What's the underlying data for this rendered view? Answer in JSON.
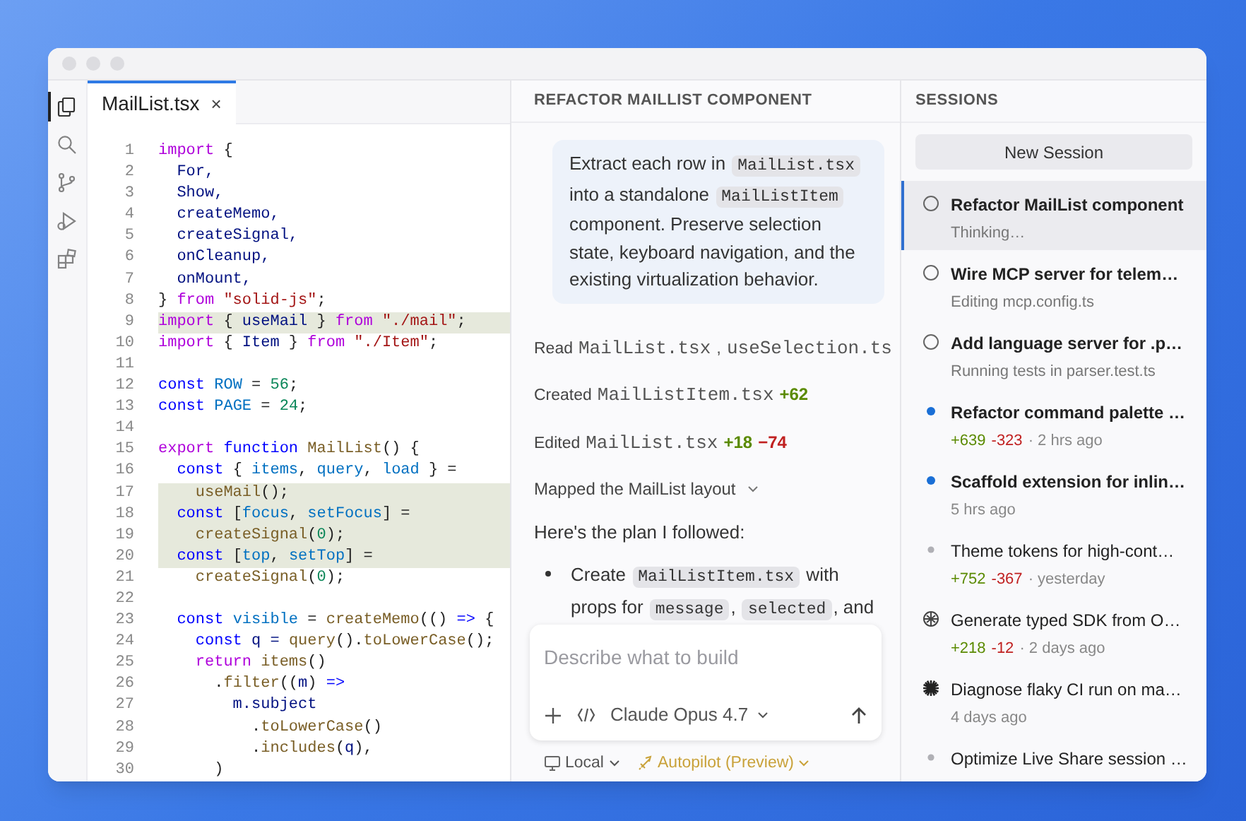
{
  "activity_bar": [
    {
      "kind": "files",
      "selected": true
    },
    {
      "kind": "search",
      "selected": false
    },
    {
      "kind": "branch",
      "selected": false
    },
    {
      "kind": "run",
      "selected": false
    },
    {
      "kind": "extensions",
      "selected": false
    }
  ],
  "editor": {
    "tabs": [
      {
        "label": "MailList.tsx",
        "close": "×",
        "selected": true
      }
    ],
    "lines": [
      {
        "number": "1",
        "highlighted": false,
        "tokens": [
          {
            "text": "import",
            "kind": "k"
          },
          {
            "text": " {",
            "kind": "p"
          }
        ]
      },
      {
        "number": "2",
        "highlighted": false,
        "tokens": [
          {
            "text": "  For,",
            "kind": "i"
          }
        ]
      },
      {
        "number": "3",
        "highlighted": false,
        "tokens": [
          {
            "text": "  Show,",
            "kind": "i"
          }
        ]
      },
      {
        "number": "4",
        "highlighted": false,
        "tokens": [
          {
            "text": "  createMemo,",
            "kind": "i"
          }
        ]
      },
      {
        "number": "5",
        "highlighted": false,
        "tokens": [
          {
            "text": "  createSignal,",
            "kind": "i"
          }
        ]
      },
      {
        "number": "6",
        "highlighted": false,
        "tokens": [
          {
            "text": "  onCleanup,",
            "kind": "i"
          }
        ]
      },
      {
        "number": "7",
        "highlighted": false,
        "tokens": [
          {
            "text": "  onMount,",
            "kind": "i"
          }
        ]
      },
      {
        "number": "8",
        "highlighted": false,
        "tokens": [
          {
            "text": "} ",
            "kind": "p"
          },
          {
            "text": "from",
            "kind": "k"
          },
          {
            "text": " \"solid-js\"",
            "kind": "s"
          },
          {
            "text": ";",
            "kind": "p"
          }
        ]
      },
      {
        "number": "9",
        "highlighted": true,
        "tokens": [
          {
            "text": "import",
            "kind": "k"
          },
          {
            "text": " { ",
            "kind": "p"
          },
          {
            "text": "useMail",
            "kind": "i"
          },
          {
            "text": " } ",
            "kind": "p"
          },
          {
            "text": "from",
            "kind": "k"
          },
          {
            "text": " \"./mail\"",
            "kind": "s"
          },
          {
            "text": ";",
            "kind": "p"
          }
        ]
      },
      {
        "number": "10",
        "highlighted": false,
        "tokens": [
          {
            "text": "import",
            "kind": "k"
          },
          {
            "text": " { ",
            "kind": "p"
          },
          {
            "text": "Item",
            "kind": "i"
          },
          {
            "text": " } ",
            "kind": "p"
          },
          {
            "text": "from",
            "kind": "k"
          },
          {
            "text": " \"./Item\"",
            "kind": "s"
          },
          {
            "text": ";",
            "kind": "p"
          }
        ]
      },
      {
        "number": "11",
        "highlighted": false
      },
      {
        "number": "12",
        "highlighted": false,
        "tokens": [
          {
            "text": "const",
            "kind": "d"
          },
          {
            "text": " ROW",
            "kind": "v"
          },
          {
            "text": " = ",
            "kind": "p"
          },
          {
            "text": "56",
            "kind": "n"
          },
          {
            "text": ";",
            "kind": "p"
          }
        ]
      },
      {
        "number": "13",
        "highlighted": false,
        "tokens": [
          {
            "text": "const",
            "kind": "d"
          },
          {
            "text": " PAGE",
            "kind": "v"
          },
          {
            "text": " = ",
            "kind": "p"
          },
          {
            "text": "24",
            "kind": "n"
          },
          {
            "text": ";",
            "kind": "p"
          }
        ]
      },
      {
        "number": "14",
        "highlighted": false
      },
      {
        "number": "15",
        "highlighted": false,
        "tokens": [
          {
            "text": "export",
            "kind": "k"
          },
          {
            "text": " function",
            "kind": "d"
          },
          {
            "text": " MailList",
            "kind": "f"
          },
          {
            "text": "() {",
            "kind": "p"
          }
        ]
      },
      {
        "number": "16",
        "highlighted": false,
        "tokens": [
          {
            "text": "  const",
            "kind": "d"
          },
          {
            "text": " { ",
            "kind": "p"
          },
          {
            "text": "items",
            "kind": "v"
          },
          {
            "text": ", ",
            "kind": "p"
          },
          {
            "text": "query",
            "kind": "v"
          },
          {
            "text": ", ",
            "kind": "p"
          },
          {
            "text": "load",
            "kind": "v"
          },
          {
            "text": " } =",
            "kind": "p"
          }
        ]
      },
      {
        "number": "17",
        "highlighted": true,
        "tokens": [
          {
            "text": "    useMail",
            "kind": "f"
          },
          {
            "text": "();",
            "kind": "p"
          }
        ]
      },
      {
        "number": "18",
        "highlighted": true,
        "tokens": [
          {
            "text": "  const",
            "kind": "d"
          },
          {
            "text": " [",
            "kind": "p"
          },
          {
            "text": "focus",
            "kind": "v"
          },
          {
            "text": ", ",
            "kind": "p"
          },
          {
            "text": "setFocus",
            "kind": "v"
          },
          {
            "text": "] =",
            "kind": "p"
          }
        ]
      },
      {
        "number": "19",
        "highlighted": true,
        "tokens": [
          {
            "text": "    createSignal",
            "kind": "f"
          },
          {
            "text": "(",
            "kind": "p"
          },
          {
            "text": "0",
            "kind": "n"
          },
          {
            "text": ");",
            "kind": "p"
          }
        ]
      },
      {
        "number": "20",
        "highlighted": true,
        "tokens": [
          {
            "text": "  const",
            "kind": "d"
          },
          {
            "text": " [",
            "kind": "p"
          },
          {
            "text": "top",
            "kind": "v"
          },
          {
            "text": ", ",
            "kind": "p"
          },
          {
            "text": "setTop",
            "kind": "v"
          },
          {
            "text": "] =",
            "kind": "p"
          }
        ]
      },
      {
        "number": "21",
        "highlighted": false,
        "tokens": [
          {
            "text": "    createSignal",
            "kind": "f"
          },
          {
            "text": "(",
            "kind": "p"
          },
          {
            "text": "0",
            "kind": "n"
          },
          {
            "text": ");",
            "kind": "p"
          }
        ]
      },
      {
        "number": "22",
        "highlighted": false
      },
      {
        "number": "23",
        "highlighted": false,
        "tokens": [
          {
            "text": "  const",
            "kind": "d"
          },
          {
            "text": " visible",
            "kind": "v"
          },
          {
            "text": " = ",
            "kind": "p"
          },
          {
            "text": "createMemo",
            "kind": "f"
          },
          {
            "text": "(() ",
            "kind": "p"
          },
          {
            "text": "=>",
            "kind": "d"
          },
          {
            "text": " {",
            "kind": "p"
          }
        ]
      },
      {
        "number": "24",
        "highlighted": false,
        "tokens": [
          {
            "text": "    const",
            "kind": "d"
          },
          {
            "text": " q = ",
            "kind": "i"
          },
          {
            "text": "query",
            "kind": "f"
          },
          {
            "text": "().",
            "kind": "p"
          },
          {
            "text": "toLowerCase",
            "kind": "f"
          },
          {
            "text": "();",
            "kind": "p"
          }
        ]
      },
      {
        "number": "25",
        "highlighted": false,
        "tokens": [
          {
            "text": "    return",
            "kind": "k"
          },
          {
            "text": " items",
            "kind": "f"
          },
          {
            "text": "()",
            "kind": "p"
          }
        ]
      },
      {
        "number": "26",
        "highlighted": false,
        "tokens": [
          {
            "text": "      .",
            "kind": "p"
          },
          {
            "text": "filter",
            "kind": "f"
          },
          {
            "text": "((",
            "kind": "p"
          },
          {
            "text": "m",
            "kind": "i"
          },
          {
            "text": ") ",
            "kind": "p"
          },
          {
            "text": "=>",
            "kind": "d"
          }
        ]
      },
      {
        "number": "27",
        "highlighted": false,
        "tokens": [
          {
            "text": "        m.subject",
            "kind": "i"
          }
        ]
      },
      {
        "number": "28",
        "highlighted": false,
        "tokens": [
          {
            "text": "          .",
            "kind": "p"
          },
          {
            "text": "toLowerCase",
            "kind": "f"
          },
          {
            "text": "()",
            "kind": "p"
          }
        ]
      },
      {
        "number": "29",
        "highlighted": false,
        "tokens": [
          {
            "text": "          .",
            "kind": "p"
          },
          {
            "text": "includes",
            "kind": "f"
          },
          {
            "text": "(",
            "kind": "p"
          },
          {
            "text": "q",
            "kind": "i"
          },
          {
            "text": "),",
            "kind": "p"
          }
        ]
      },
      {
        "number": "30",
        "highlighted": false,
        "tokens": [
          {
            "text": "      )",
            "kind": "p"
          }
        ]
      }
    ]
  },
  "chat": {
    "title": "REFACTOR MAILLIST COMPONENT",
    "messages": [
      {
        "kind": "user",
        "segments": [
          {
            "kind": "text",
            "text": "Extract each row in "
          },
          {
            "kind": "code",
            "text": "MailList.tsx"
          },
          {
            "kind": "text",
            "text": " into a standalone "
          },
          {
            "kind": "code",
            "text": "MailListItem"
          },
          {
            "kind": "text",
            "text": " component. Preserve selection state, keyboard navigation, and the existing virtualization behavior."
          }
        ]
      },
      {
        "kind": "activity",
        "label": "Read",
        "parts": [
          {
            "kind": "file",
            "text": "MailList.tsx"
          },
          {
            "kind": "sep",
            "text": ","
          },
          {
            "kind": "file",
            "text": "useSelection.ts"
          }
        ]
      },
      {
        "kind": "activity",
        "label": "Created",
        "parts": [
          {
            "kind": "file",
            "text": "MailListItem.tsx"
          },
          {
            "kind": "add",
            "text": "+62"
          }
        ]
      },
      {
        "kind": "activity",
        "label": "Edited",
        "parts": [
          {
            "kind": "file",
            "text": "MailList.tsx"
          },
          {
            "kind": "add",
            "text": "+18"
          },
          {
            "kind": "del",
            "text": "−74"
          }
        ]
      },
      {
        "kind": "disclosure",
        "text": "Mapped the MailList layout"
      },
      {
        "kind": "text",
        "text": "Here's the plan I followed:"
      },
      {
        "kind": "bullet",
        "segments": [
          {
            "kind": "text",
            "text": "Create "
          },
          {
            "kind": "code",
            "text": "MailListItem.tsx"
          },
          {
            "kind": "text",
            "text": " with props for "
          },
          {
            "kind": "code",
            "text": "message"
          },
          {
            "kind": "text",
            "text": ", "
          },
          {
            "kind": "code",
            "text": "selected"
          },
          {
            "kind": "text",
            "text": ", and"
          }
        ]
      }
    ],
    "composer": {
      "placeholder": "Describe what to build",
      "model": "Claude Opus 4.7"
    },
    "footer": {
      "location": "Local",
      "mode": "Autopilot (Preview)"
    }
  },
  "sessions": {
    "title": "SESSIONS",
    "new_button": "New Session",
    "items": [
      {
        "kind": "running",
        "title": "Refactor MailList component",
        "selected": true,
        "detail": "Thinking…"
      },
      {
        "kind": "running",
        "title": "Wire MCP server for telem…",
        "selected": false,
        "detail": "Editing mcp.config.ts"
      },
      {
        "kind": "running",
        "title": "Add language server for .p…",
        "selected": false,
        "detail": "Running tests in parser.test.ts"
      },
      {
        "kind": "unread",
        "title": "Refactor command palette …",
        "selected": false,
        "added": "+639",
        "removed": "-323",
        "time": "· 2 hrs ago"
      },
      {
        "kind": "unread",
        "title": "Scaffold extension for inlin…",
        "selected": false,
        "time": "5 hrs ago"
      },
      {
        "kind": "read",
        "title": "Theme tokens for high-cont…",
        "selected": false,
        "added": "+752",
        "removed": "-367",
        "time": "· yesterday"
      },
      {
        "kind": "knot",
        "title": "Generate typed SDK from O…",
        "selected": false,
        "added": "+218",
        "removed": "-12",
        "time": "· 2 days ago"
      },
      {
        "kind": "burst",
        "title": "Diagnose flaky CI run on ma…",
        "selected": false,
        "time": "4 days ago"
      },
      {
        "kind": "read",
        "title": "Optimize Live Share session …",
        "selected": false
      }
    ]
  }
}
